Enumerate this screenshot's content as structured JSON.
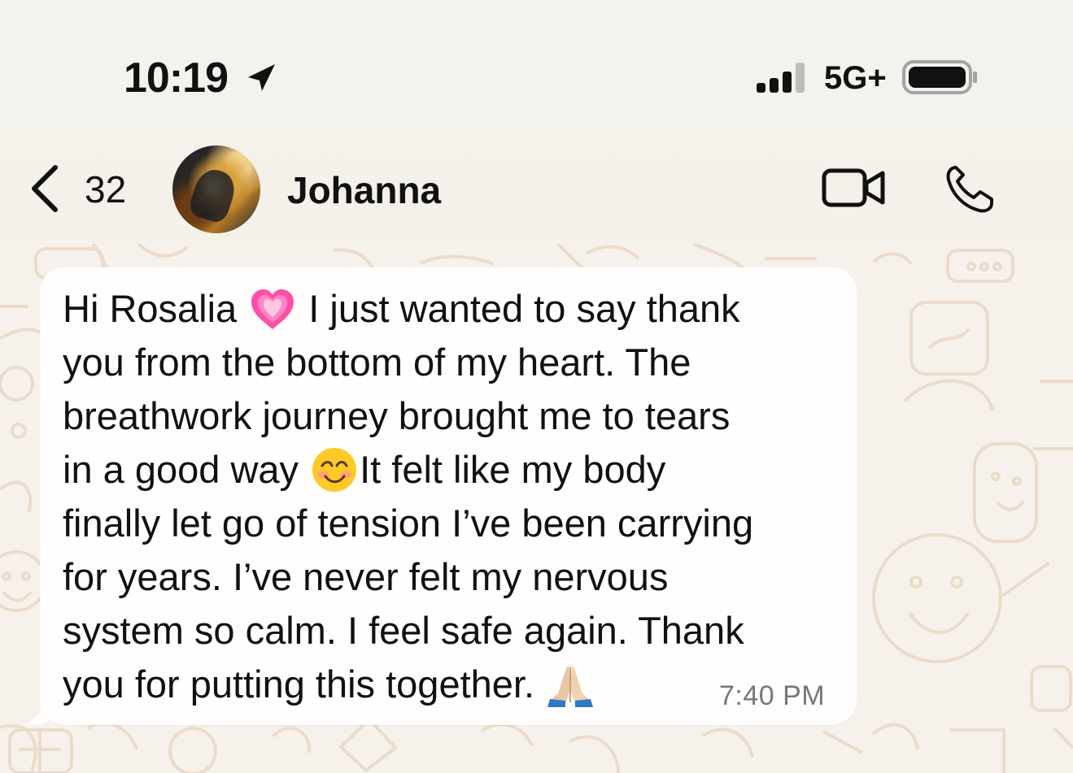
{
  "status_bar": {
    "time": "10:19",
    "location_icon": "location-arrow-icon",
    "signal_icon": "cellular-signal-icon",
    "network": "5G+",
    "battery_icon": "battery-icon"
  },
  "header": {
    "back_icon": "chevron-left-icon",
    "back_count": "32",
    "contact_name": "Johanna",
    "video_icon": "video-camera-icon",
    "phone_icon": "phone-icon"
  },
  "message": {
    "line1_a": "Hi Rosalia ",
    "line1_b": " I just wanted to say thank",
    "line2": "you from the bottom of my heart. The",
    "line3": "breathwork journey brought me to tears",
    "line4_a": "in a good way ",
    "line4_b": "It felt like my body",
    "line5": "finally let go of tension I’ve been carrying",
    "line6": "for years. I’ve never felt my nervous",
    "line7": "system so calm. I feel safe again. Thank",
    "line8": "you for putting this together. ",
    "heart_icon": "growing-heart-icon",
    "smile_icon": "smiling-face-icon",
    "prayer_icon": "folded-hands-icon",
    "time": "7:40 PM"
  },
  "colors": {
    "background": "#f5f2ec",
    "bubble": "#fffefc",
    "text": "#111111",
    "time_text": "#777777",
    "pattern": "#ead8c6"
  }
}
